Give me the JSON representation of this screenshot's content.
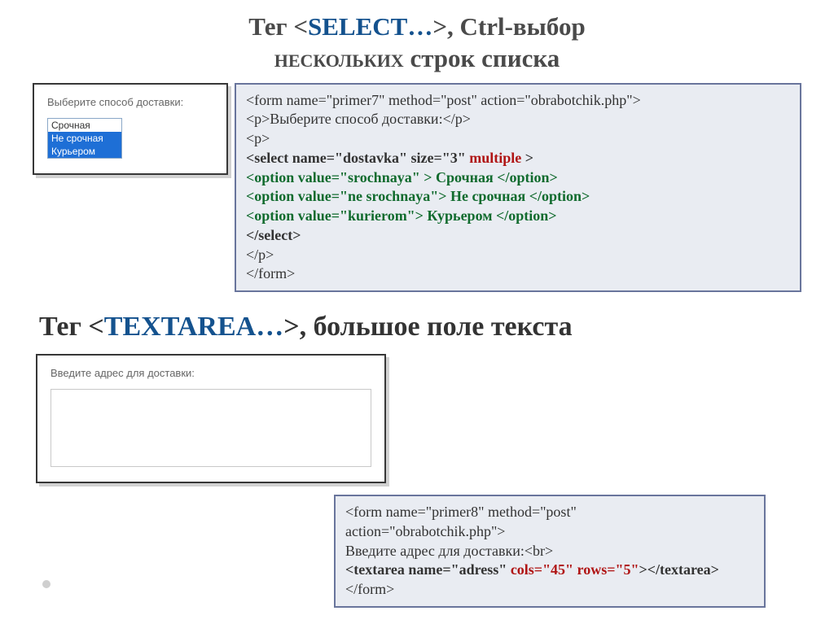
{
  "title1": {
    "part1": "Тег <",
    "select": "SELECT…",
    "part2": ">, Ctrl-выбор ",
    "part3": "нескольких",
    "part4": " строк списка"
  },
  "preview1": {
    "label": "Выберите способ доставки:",
    "opt1": "Срочная",
    "opt2": "Не срочная",
    "opt3": "Курьером"
  },
  "code1": {
    "l1": "<form name=\"primer7\" method=\"post\" action=\"obrabotchik.php\">",
    "l2": "<p>Выберите способ доставки:</p>",
    "l3": "<p>",
    "l4a": "<select name=\"dostavka\" size=\"3\" ",
    "l4b": "multiple",
    "l4c": " >",
    "l5": "<option value=\"srochnaya\" > Срочная </option>",
    "l6": "<option value=\"ne srochnaya\"> Не срочная </option>",
    "l7": "<option value=\"kurierom\"> Курьером </option>",
    "l8": "</select>",
    "l9": "</p>",
    "l10": "</form>"
  },
  "title2": {
    "part1": "Тег <",
    "textarea": "TEXTAREA…",
    "part2": ">, большое поле текста"
  },
  "preview2": {
    "label": "Введите адрес для доставки:"
  },
  "code2": {
    "l1": "<form name=\"primer8\" method=\"post\"",
    "l2": "action=\"obrabotchik.php\">",
    "l3": "Введите адрес для доставки:<br>",
    "l4a": "<textarea name=\"adress\" ",
    "l4b": "cols=\"45\" rows=\"5\"",
    "l4c": "></textarea>",
    "l5": "</form>"
  }
}
